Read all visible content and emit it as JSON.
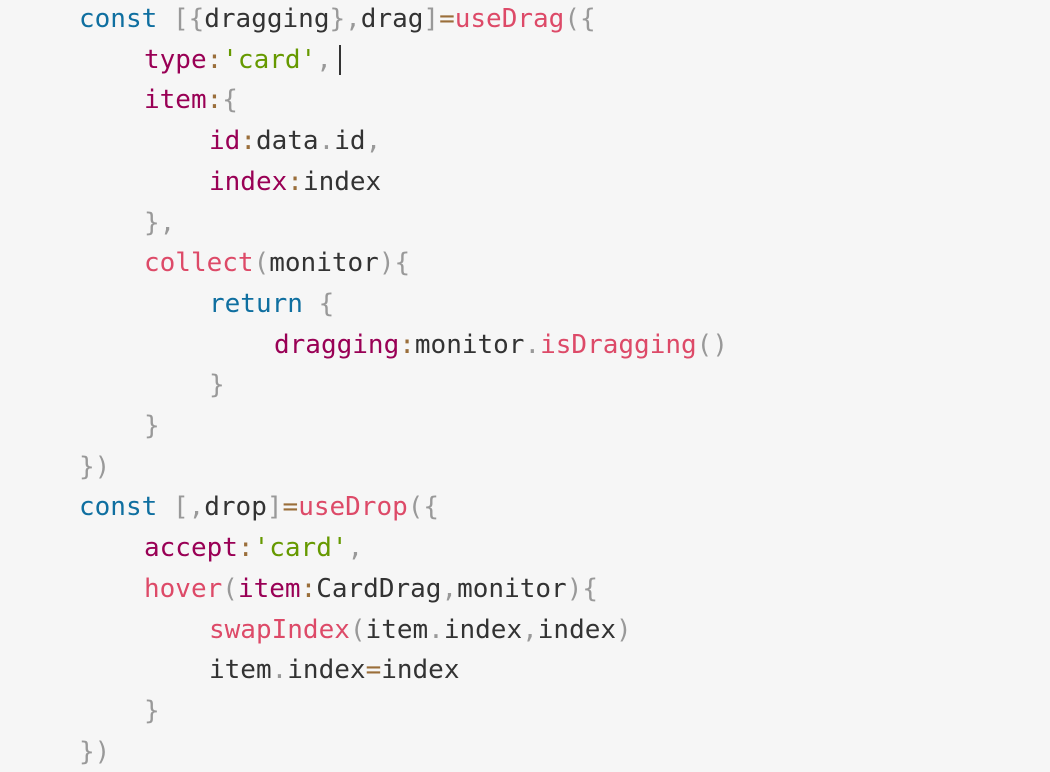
{
  "editor": {
    "lines": [
      {
        "indent": 0,
        "tokens": [
          {
            "t": "const",
            "c": "kw"
          },
          {
            "t": " ",
            "c": "var"
          },
          {
            "t": "[{",
            "c": "punc"
          },
          {
            "t": "dragging",
            "c": "var"
          },
          {
            "t": "},",
            "c": "punc"
          },
          {
            "t": "drag",
            "c": "var"
          },
          {
            "t": "]",
            "c": "punc"
          },
          {
            "t": "=",
            "c": "op"
          },
          {
            "t": "useDrag",
            "c": "fn"
          },
          {
            "t": "({",
            "c": "punc"
          }
        ]
      },
      {
        "indent": 1,
        "tokens": [
          {
            "t": "type",
            "c": "prop"
          },
          {
            "t": ":",
            "c": "op"
          },
          {
            "t": "'card'",
            "c": "str"
          },
          {
            "t": ",",
            "c": "punc"
          }
        ]
      },
      {
        "indent": 1,
        "tokens": [
          {
            "t": "item",
            "c": "prop"
          },
          {
            "t": ":",
            "c": "op"
          },
          {
            "t": "{",
            "c": "punc"
          }
        ]
      },
      {
        "indent": 2,
        "tokens": [
          {
            "t": "id",
            "c": "prop"
          },
          {
            "t": ":",
            "c": "op"
          },
          {
            "t": "data",
            "c": "var"
          },
          {
            "t": ".",
            "c": "punc"
          },
          {
            "t": "id",
            "c": "var"
          },
          {
            "t": ",",
            "c": "punc"
          }
        ]
      },
      {
        "indent": 2,
        "tokens": [
          {
            "t": "index",
            "c": "prop"
          },
          {
            "t": ":",
            "c": "op"
          },
          {
            "t": "index",
            "c": "var"
          }
        ]
      },
      {
        "indent": 1,
        "tokens": [
          {
            "t": "},",
            "c": "punc"
          }
        ]
      },
      {
        "indent": 1,
        "tokens": [
          {
            "t": "collect",
            "c": "fn"
          },
          {
            "t": "(",
            "c": "punc"
          },
          {
            "t": "monitor",
            "c": "var"
          },
          {
            "t": "){",
            "c": "punc"
          }
        ]
      },
      {
        "indent": 2,
        "tokens": [
          {
            "t": "return",
            "c": "kw"
          },
          {
            "t": " ",
            "c": "var"
          },
          {
            "t": "{",
            "c": "punc"
          }
        ]
      },
      {
        "indent": 3,
        "tokens": [
          {
            "t": "dragging",
            "c": "prop"
          },
          {
            "t": ":",
            "c": "op"
          },
          {
            "t": "monitor",
            "c": "var"
          },
          {
            "t": ".",
            "c": "punc"
          },
          {
            "t": "isDragging",
            "c": "fn"
          },
          {
            "t": "()",
            "c": "punc"
          }
        ]
      },
      {
        "indent": 2,
        "tokens": [
          {
            "t": "}",
            "c": "punc"
          }
        ]
      },
      {
        "indent": 1,
        "tokens": [
          {
            "t": "}",
            "c": "punc"
          }
        ]
      },
      {
        "indent": 0,
        "tokens": [
          {
            "t": "})",
            "c": "punc"
          }
        ]
      },
      {
        "indent": 0,
        "tokens": [
          {
            "t": "const",
            "c": "kw"
          },
          {
            "t": " ",
            "c": "var"
          },
          {
            "t": "[,",
            "c": "punc"
          },
          {
            "t": "drop",
            "c": "var"
          },
          {
            "t": "]",
            "c": "punc"
          },
          {
            "t": "=",
            "c": "op"
          },
          {
            "t": "useDrop",
            "c": "fn"
          },
          {
            "t": "({",
            "c": "punc"
          }
        ]
      },
      {
        "indent": 1,
        "tokens": [
          {
            "t": "accept",
            "c": "prop"
          },
          {
            "t": ":",
            "c": "op"
          },
          {
            "t": "'card'",
            "c": "str"
          },
          {
            "t": ",",
            "c": "punc"
          }
        ]
      },
      {
        "indent": 1,
        "tokens": [
          {
            "t": "hover",
            "c": "fn"
          },
          {
            "t": "(",
            "c": "punc"
          },
          {
            "t": "item",
            "c": "prop"
          },
          {
            "t": ":",
            "c": "op"
          },
          {
            "t": "CardDrag",
            "c": "var"
          },
          {
            "t": ",",
            "c": "punc"
          },
          {
            "t": "monitor",
            "c": "var"
          },
          {
            "t": "){",
            "c": "punc"
          }
        ]
      },
      {
        "indent": 2,
        "tokens": [
          {
            "t": "swapIndex",
            "c": "fn"
          },
          {
            "t": "(",
            "c": "punc"
          },
          {
            "t": "item",
            "c": "var"
          },
          {
            "t": ".",
            "c": "punc"
          },
          {
            "t": "index",
            "c": "var"
          },
          {
            "t": ",",
            "c": "punc"
          },
          {
            "t": "index",
            "c": "var"
          },
          {
            "t": ")",
            "c": "punc"
          }
        ]
      },
      {
        "indent": 2,
        "tokens": [
          {
            "t": "item",
            "c": "var"
          },
          {
            "t": ".",
            "c": "punc"
          },
          {
            "t": "index",
            "c": "var"
          },
          {
            "t": "=",
            "c": "op"
          },
          {
            "t": "index",
            "c": "var"
          }
        ]
      },
      {
        "indent": 1,
        "tokens": [
          {
            "t": "}",
            "c": "punc"
          }
        ]
      },
      {
        "indent": 0,
        "tokens": [
          {
            "t": "})",
            "c": "punc"
          }
        ]
      }
    ]
  }
}
